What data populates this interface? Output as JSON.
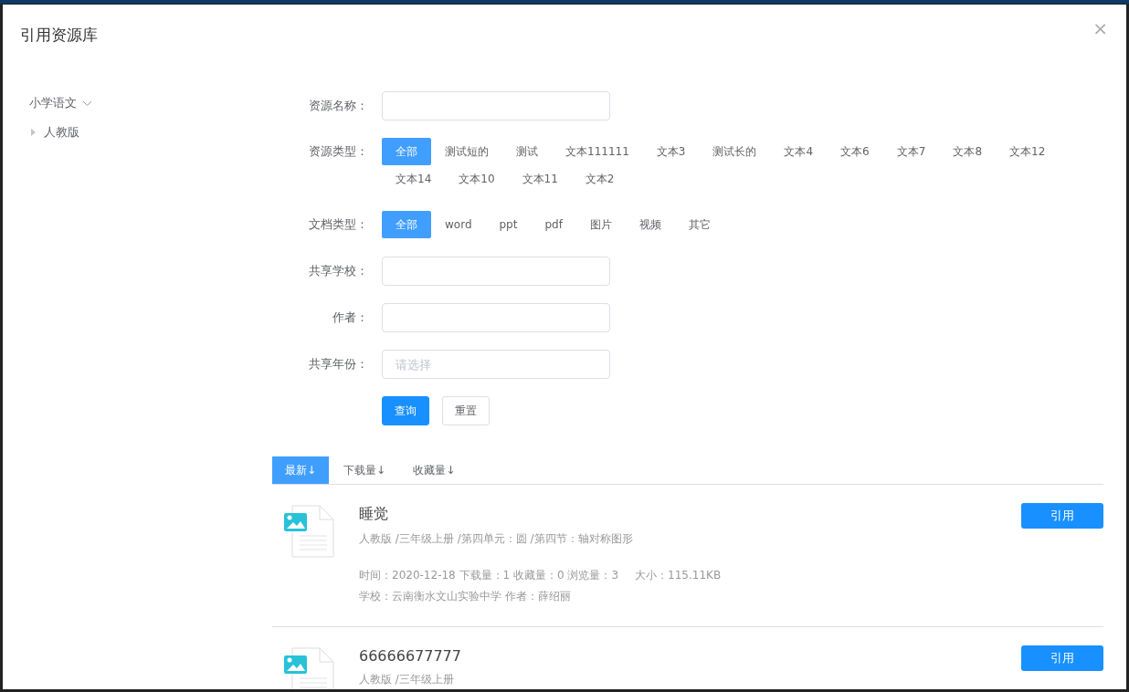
{
  "dialog": {
    "title": "引用资源库",
    "close": "×"
  },
  "sidebar": {
    "items": [
      {
        "label": "小学语文",
        "expanded": true,
        "children": [
          {
            "label": "人教版",
            "expanded": false
          }
        ]
      }
    ]
  },
  "filters": [
    {
      "kind": "input",
      "label": "资源名称："
    },
    {
      "kind": "tags",
      "label": "资源类型：",
      "options": [
        {
          "label": "全部",
          "selected": true
        },
        {
          "label": "测试短的",
          "selected": false
        },
        {
          "label": "测试",
          "selected": false
        },
        {
          "label": "文本111111",
          "selected": false
        },
        {
          "label": "文本3",
          "selected": false
        },
        {
          "label": "测试长的",
          "selected": false
        },
        {
          "label": "文本4",
          "selected": false
        },
        {
          "label": "文本6",
          "selected": false
        },
        {
          "label": "文本7",
          "selected": false
        },
        {
          "label": "文本8",
          "selected": false
        },
        {
          "label": "文本12",
          "selected": false
        },
        {
          "label": "文本14",
          "selected": false
        },
        {
          "label": "文本10",
          "selected": false
        },
        {
          "label": "文本11",
          "selected": false
        },
        {
          "label": "文本2",
          "selected": false
        }
      ]
    },
    {
      "kind": "tags",
      "label": "文档类型：",
      "options": [
        {
          "label": "全部",
          "selected": true
        },
        {
          "label": "word",
          "selected": false
        },
        {
          "label": "ppt",
          "selected": false
        },
        {
          "label": "pdf",
          "selected": false
        },
        {
          "label": "图片",
          "selected": false
        },
        {
          "label": "视频",
          "selected": false
        },
        {
          "label": "其它",
          "selected": false
        }
      ]
    },
    {
      "kind": "input",
      "label": "共享学校："
    },
    {
      "kind": "input",
      "label": "作者："
    },
    {
      "kind": "select",
      "label": "共享年份：",
      "placeholder": "请选择"
    }
  ],
  "actions": {
    "search": "查询",
    "reset": "重置"
  },
  "sort_tabs": [
    {
      "label": "最新↓",
      "selected": true
    },
    {
      "label": "下载量↓",
      "selected": false
    },
    {
      "label": "收藏量↓",
      "selected": false
    }
  ],
  "resources": [
    {
      "title": "睡觉",
      "path": "人教版 /三年级上册 /第四单元：圆 /第四节：轴对称图形",
      "stats": "时间：2020-12-18 下载量：1 收藏量：0 浏览量：3",
      "size": "大小：115.11KB",
      "school": "学校：云南衡水文山实验中学 作者：薛绍丽",
      "button": "引用"
    },
    {
      "title": "66666677777",
      "path": "人教版 /三年级上册",
      "button": "引用"
    }
  ]
}
